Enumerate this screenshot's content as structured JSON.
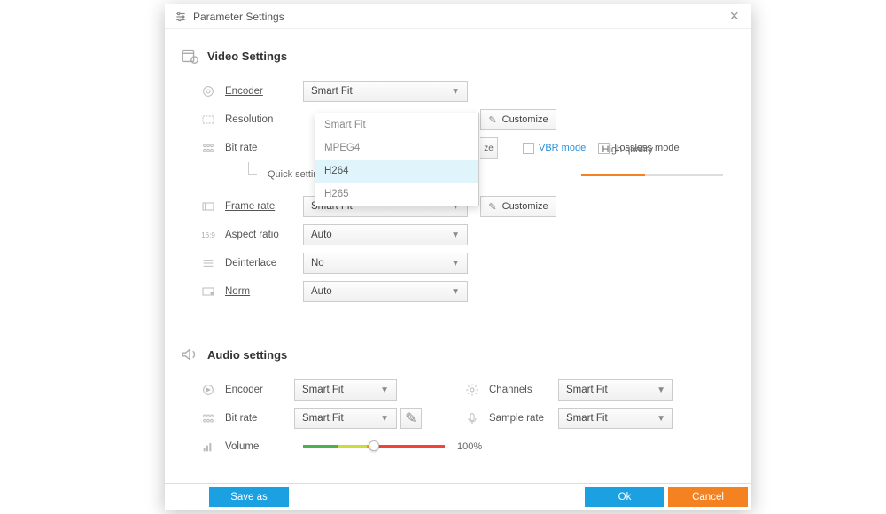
{
  "title": "Parameter Settings",
  "sections": {
    "video": {
      "title": "Video Settings"
    },
    "audio": {
      "title": "Audio settings"
    }
  },
  "video": {
    "encoder": {
      "label": "Encoder",
      "value": "Smart Fit"
    },
    "resolution": {
      "label": "Resolution",
      "customize": "Customize"
    },
    "bitrate": {
      "label": "Bit rate",
      "customize_tail": "ze",
      "vbr": "VBR mode",
      "lossless": "Lossless mode"
    },
    "quick": {
      "label": "Quick setting",
      "quality": "High quality"
    },
    "framerate": {
      "label": "Frame rate",
      "value": "Smart Fit",
      "customize": "Customize"
    },
    "aspect": {
      "label": "Aspect ratio",
      "value": "Auto"
    },
    "deinterlace": {
      "label": "Deinterlace",
      "value": "No"
    },
    "norm": {
      "label": "Norm",
      "value": "Auto"
    }
  },
  "encoder_options": [
    "Smart Fit",
    "MPEG4",
    "H264",
    "H265"
  ],
  "audio": {
    "encoder": {
      "label": "Encoder",
      "value": "Smart Fit"
    },
    "bitrate": {
      "label": "Bit rate",
      "value": "Smart Fit"
    },
    "channels": {
      "label": "Channels",
      "value": "Smart Fit"
    },
    "samplerate": {
      "label": "Sample rate",
      "value": "Smart Fit"
    },
    "volume": {
      "label": "Volume",
      "value": "100%"
    }
  },
  "footer": {
    "save": "Save as",
    "ok": "Ok",
    "cancel": "Cancel"
  }
}
